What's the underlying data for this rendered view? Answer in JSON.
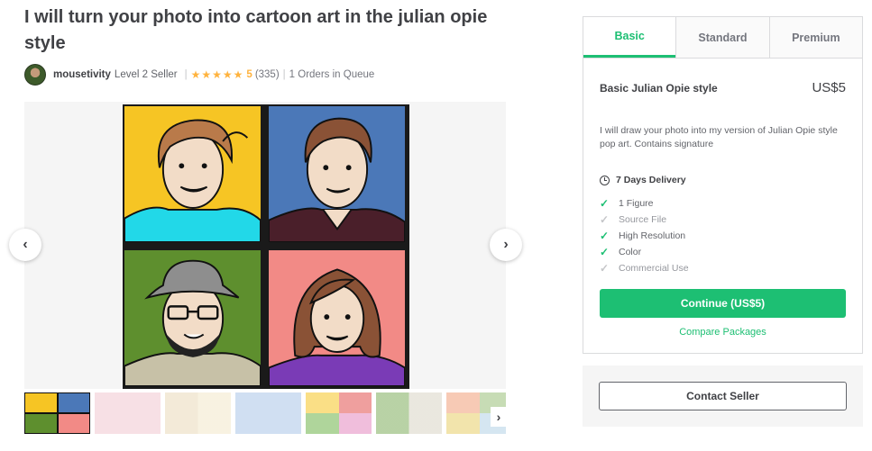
{
  "gig": {
    "title": "I will turn your photo into cartoon art in the julian opie style"
  },
  "seller": {
    "name": "mousetivity",
    "level": "Level 2 Seller",
    "separator": "|",
    "stars": "★★★★★",
    "rating": "5",
    "reviews": "(335)",
    "queue": "1 Orders in Queue"
  },
  "gallery": {
    "prev_icon": "chevron-left-icon",
    "next_icon": "chevron-right-icon",
    "prev_glyph": "‹",
    "next_glyph": "›",
    "panel_colors": [
      "#f6c524",
      "#4b78b8",
      "#5e8f2e",
      "#f28a86"
    ],
    "thumb_count": 7
  },
  "package": {
    "tabs": [
      {
        "label": "Basic",
        "active": true
      },
      {
        "label": "Standard",
        "active": false
      },
      {
        "label": "Premium",
        "active": false
      }
    ],
    "name": "Basic Julian Opie style",
    "price": "US$5",
    "description": "I will draw your photo into my version of Julian Opie style pop art. Contains signature",
    "delivery": "7 Days Delivery",
    "features": [
      {
        "label": "1 Figure",
        "included": true
      },
      {
        "label": "Source File",
        "included": false
      },
      {
        "label": "High Resolution",
        "included": true
      },
      {
        "label": "Color",
        "included": true
      },
      {
        "label": "Commercial Use",
        "included": false
      }
    ],
    "continue_label": "Continue (US$5)",
    "compare_label": "Compare Packages"
  },
  "contact": {
    "label": "Contact Seller"
  },
  "colors": {
    "accent": "#1dbf73",
    "star": "#ffb33e",
    "text": "#404145"
  }
}
